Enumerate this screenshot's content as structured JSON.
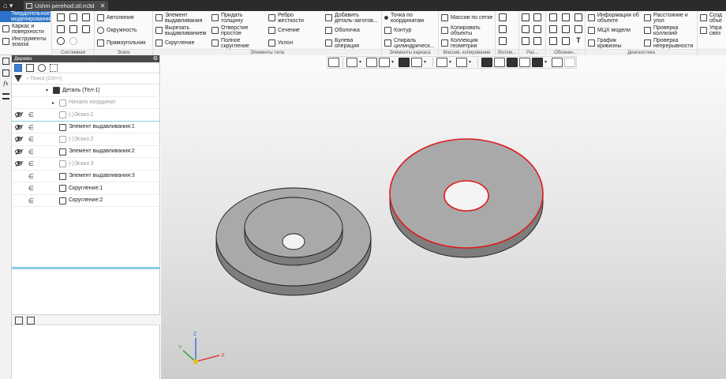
{
  "titlebar": {
    "home_icon": "home-icon",
    "tab_title": "Ushm perehod.stl.m3d",
    "close": "✕"
  },
  "ribbon": {
    "mode": {
      "label1": "Твердотельное",
      "label2": "моделирование"
    },
    "mode_items": [
      {
        "l1": "Каркас и",
        "l2": "поверхности"
      },
      {
        "l1": "Инструменты",
        "l2": "эскиза"
      }
    ],
    "groups": {
      "system": "Системная",
      "sketch": "Эскиз",
      "body": "Элементы тела",
      "frame": "Элементы каркаса",
      "array": "Массив, копирование",
      "aux": "Вспом...",
      "size": "Раз...",
      "notation": "Обознач...",
      "diag": "Диагностика"
    },
    "sketch_items": [
      "Автолиния",
      "Окружность",
      "Прямоугольник"
    ],
    "body_items": [
      {
        "l1": "Элемент",
        "l2": "выдавливания"
      },
      {
        "l1": "Вырезать",
        "l2": "выдавливанием"
      },
      {
        "l1": "Скругление",
        "l2": ""
      },
      {
        "l1": "Придать",
        "l2": "толщину"
      },
      {
        "l1": "Отверстие",
        "l2": "простое"
      },
      {
        "l1": "Полное",
        "l2": "скругление"
      },
      {
        "l1": "Ребро",
        "l2": "жесткости"
      },
      {
        "l1": "Сечение",
        "l2": ""
      },
      {
        "l1": "Уклон",
        "l2": ""
      },
      {
        "l1": "Добавить",
        "l2": "деталь-заготов..."
      },
      {
        "l1": "Оболочка",
        "l2": ""
      },
      {
        "l1": "Булева",
        "l2": "операция"
      }
    ],
    "frame_items": [
      {
        "l1": "Точка по",
        "l2": "координатам"
      },
      {
        "l1": "Контур",
        "l2": ""
      },
      {
        "l1": "Спираль",
        "l2": "цилиндрическ..."
      }
    ],
    "array_items": [
      {
        "l1": "Массив по сетке",
        "l2": ""
      },
      {
        "l1": "Копировать",
        "l2": "объекты"
      },
      {
        "l1": "Коллекция",
        "l2": "геометрии"
      }
    ],
    "diag_items": [
      {
        "l1": "Информация об",
        "l2": "объекте"
      },
      {
        "l1": "МЦХ модели",
        "l2": ""
      },
      {
        "l1": "График",
        "l2": "кривизны"
      },
      {
        "l1": "Расстояние и",
        "l2": "угол"
      },
      {
        "l1": "Проверка",
        "l2": "коллизий"
      },
      {
        "l1": "Проверка",
        "l2": "непрерывности"
      }
    ],
    "edge_items": [
      {
        "l1": "Созд",
        "l2": "объе"
      },
      {
        "l1": "Упра",
        "l2": "связ"
      }
    ]
  },
  "tree": {
    "title": "Дерево",
    "search_placeholder": "Поиск (Ctrl+/)",
    "rows": [
      {
        "text": "Деталь (Тел-1)",
        "eye": false,
        "eps": false,
        "dim": false,
        "indent": 2,
        "arrow": "▾"
      },
      {
        "text": "Начало координат",
        "eye": false,
        "eps": false,
        "dim": true,
        "indent": 3,
        "arrow": "▸"
      },
      {
        "text": "(-)Эскиз:1",
        "eye": true,
        "eps": true,
        "dim": true,
        "indent": 3,
        "arrow": ""
      },
      {
        "text": "Элемент выдавливания:1",
        "eye": true,
        "eps": true,
        "dim": false,
        "indent": 3,
        "arrow": ""
      },
      {
        "text": "(-)Эскиз:2",
        "eye": true,
        "eps": true,
        "dim": true,
        "indent": 3,
        "arrow": ""
      },
      {
        "text": "Элемент выдавливания:2",
        "eye": true,
        "eps": true,
        "dim": false,
        "indent": 3,
        "arrow": ""
      },
      {
        "text": "(-)Эскиз:3",
        "eye": true,
        "eps": true,
        "dim": true,
        "indent": 3,
        "arrow": ""
      },
      {
        "text": "Элемент выдавливания:3",
        "eye": false,
        "eps": true,
        "dim": false,
        "indent": 3,
        "arrow": ""
      },
      {
        "text": "Скругление:1",
        "eye": false,
        "eps": true,
        "dim": false,
        "indent": 3,
        "arrow": ""
      },
      {
        "text": "Скругление:2",
        "eye": false,
        "eps": true,
        "dim": false,
        "indent": 3,
        "arrow": ""
      }
    ]
  },
  "viewport": {
    "axis_labels": {
      "x": "X",
      "y": "Y",
      "z": "Z"
    },
    "colors": {
      "part_top": "#a9a9a9",
      "part_side": "#7d7d7d",
      "highlight": "#e01a1a",
      "edge": "#1a1a1a"
    }
  }
}
